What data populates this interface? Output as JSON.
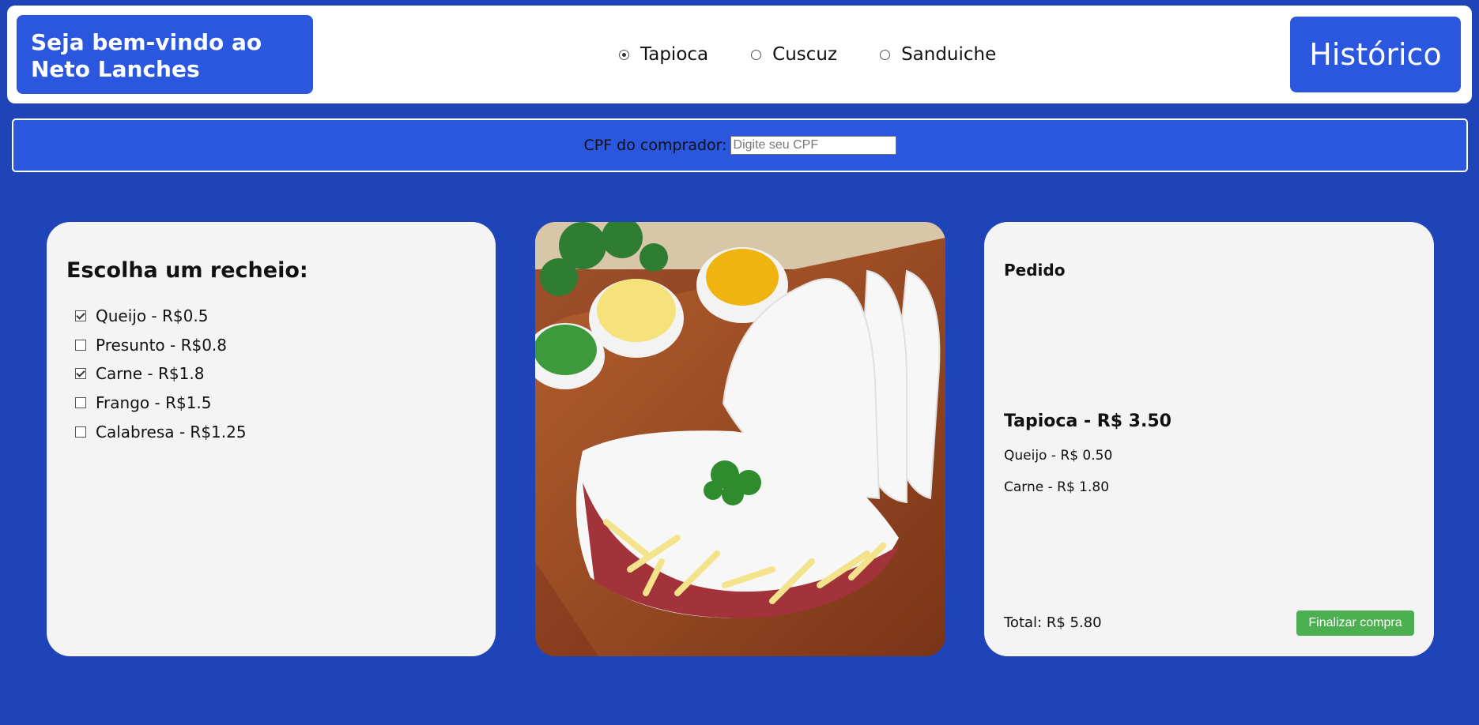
{
  "header": {
    "brand_line1": "Seja bem-vindo ao",
    "brand_line2": "Neto Lanches",
    "product_options": [
      {
        "label": "Tapioca",
        "selected": true
      },
      {
        "label": "Cuscuz",
        "selected": false
      },
      {
        "label": "Sanduiche",
        "selected": false
      }
    ],
    "history_button": "Histórico"
  },
  "cpf": {
    "label": "CPF do comprador:",
    "placeholder": "Digite seu CPF",
    "value": ""
  },
  "fillings": {
    "title": "Escolha um recheio:",
    "items": [
      {
        "label": "Queijo - R$0.5",
        "checked": true
      },
      {
        "label": "Presunto - R$0.8",
        "checked": false
      },
      {
        "label": "Carne - R$1.8",
        "checked": true
      },
      {
        "label": "Frango - R$1.5",
        "checked": false
      },
      {
        "label": "Calabresa - R$1.25",
        "checked": false
      }
    ]
  },
  "product_image": {
    "alt": "tapioca-photo"
  },
  "order": {
    "title": "Pedido",
    "item_title": "Tapioca - R$ 3.50",
    "lines": [
      "Queijo - R$ 0.50",
      "Carne - R$ 1.80"
    ],
    "total": "Total: R$ 5.80",
    "finish_button": "Finalizar compra"
  },
  "colors": {
    "background": "#1e44b8",
    "accent": "#2b57de",
    "finish": "#4caf50"
  }
}
